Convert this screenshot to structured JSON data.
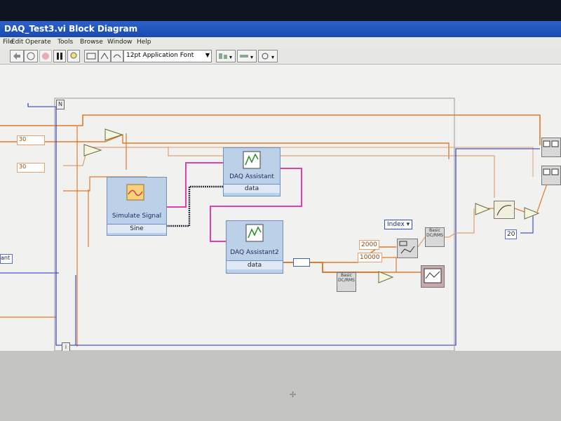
{
  "window": {
    "title": "DAQ_Test3.vi Block Diagram"
  },
  "menu": [
    "File",
    "Edit",
    "Operate",
    "Tools",
    "Browse",
    "Window",
    "Help"
  ],
  "toolbar": {
    "font": "12pt Application Font"
  },
  "loop": {
    "count_terminal": "N",
    "iteration_terminal": "i"
  },
  "nodes": {
    "simulate": {
      "label": "Simulate Signal",
      "output": "Sine"
    },
    "daq1": {
      "label": "DAQ Assistant",
      "output": "data"
    },
    "daq2": {
      "label": "DAQ Assistant2",
      "output": "data"
    }
  },
  "constants": {
    "c2000": "2000",
    "c10000": "10000",
    "c20": "20",
    "index": "Index",
    "left1": "30",
    "left2": "30",
    "left3": "ant"
  },
  "basic_vi": "Basic DC/RMS",
  "colors": {
    "orange_wire": "#e07a2c",
    "pink_wire": "#e040a8",
    "blue_wire": "#2030c0"
  }
}
